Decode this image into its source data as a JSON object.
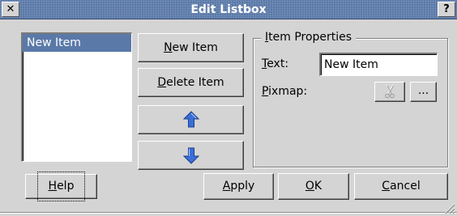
{
  "window": {
    "title": "Edit Listbox",
    "close_glyph": "✕",
    "help_glyph": "?"
  },
  "list": {
    "items": [
      "New Item"
    ],
    "selected_index": 0
  },
  "buttons": {
    "new_item": "New Item",
    "delete_item": "Delete Item",
    "move_up_icon": "arrow-up-icon",
    "move_down_icon": "arrow-down-icon",
    "help": "Help",
    "apply": "Apply",
    "ok": "OK",
    "cancel": "Cancel"
  },
  "properties": {
    "group_title": "Item Properties",
    "text_label": "Text:",
    "text_value": "New Item",
    "pixmap_label": "Pixmap:",
    "pixmap_clear_icon": "scissors-icon",
    "pixmap_browse": "..."
  },
  "colors": {
    "titlebar": "#5a79a8",
    "selection": "#5a79a8",
    "arrow": "#3a6fd8",
    "face": "#d4d4d4"
  }
}
